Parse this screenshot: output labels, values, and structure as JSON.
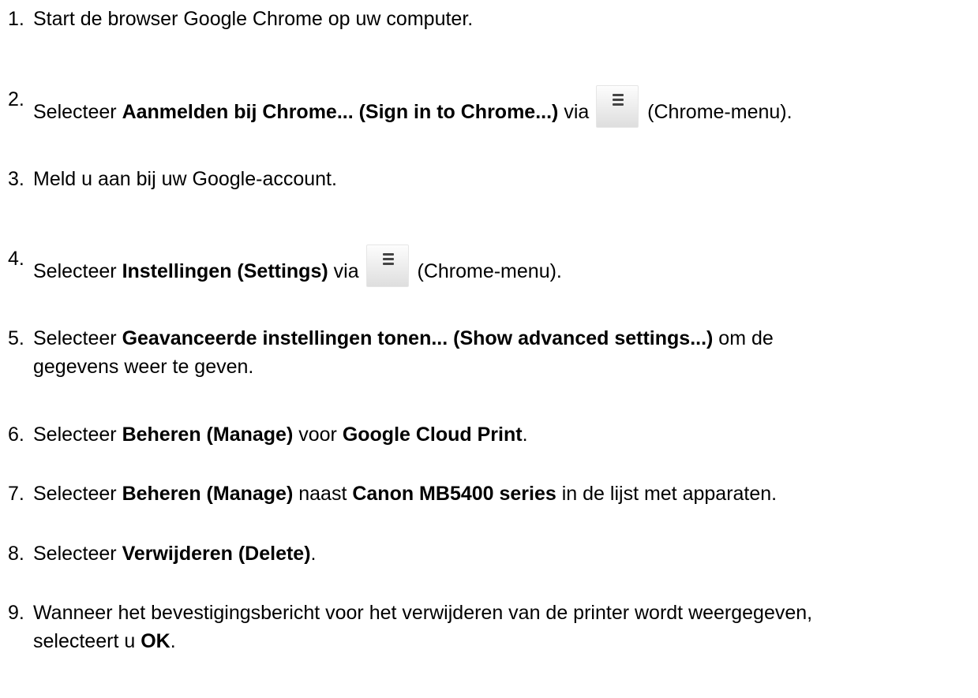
{
  "steps": [
    {
      "num": "1.",
      "t1": "Start de browser Google Chrome op uw computer."
    },
    {
      "num": "2.",
      "t1": "Selecteer ",
      "b1": "Aanmelden bij Chrome... (Sign in to Chrome...)",
      "t2": " via ",
      "t3": " (Chrome-menu).",
      "icon": "chrome-menu-icon"
    },
    {
      "num": "3.",
      "t1": "Meld u aan bij uw Google-account."
    },
    {
      "num": "4.",
      "t1": "Selecteer ",
      "b1": "Instellingen (Settings)",
      "t2": " via ",
      "t3": " (Chrome-menu).",
      "icon": "chrome-menu-icon"
    },
    {
      "num": "5.",
      "t1": "Selecteer ",
      "b1": "Geavanceerde instellingen tonen... (Show advanced settings...)",
      "t2": " om de",
      "t3": "gegevens weer te geven."
    },
    {
      "num": "6.",
      "t1": "Selecteer ",
      "b1": "Beheren (Manage)",
      "t2": " voor ",
      "b2": "Google Cloud Print",
      "t3": "."
    },
    {
      "num": "7.",
      "t1": "Selecteer ",
      "b1": "Beheren (Manage)",
      "t2": " naast ",
      "b2": "Canon MB5400 series",
      "t3": " in de lijst met apparaten."
    },
    {
      "num": "8.",
      "t1": "Selecteer ",
      "b1": "Verwijderen (Delete)",
      "t2": "."
    },
    {
      "num": "9.",
      "t1": "Wanneer het bevestigingsbericht voor het verwijderen van de printer wordt weergegeven,",
      "t2": "selecteert u ",
      "b1": "OK",
      "t3": "."
    }
  ]
}
